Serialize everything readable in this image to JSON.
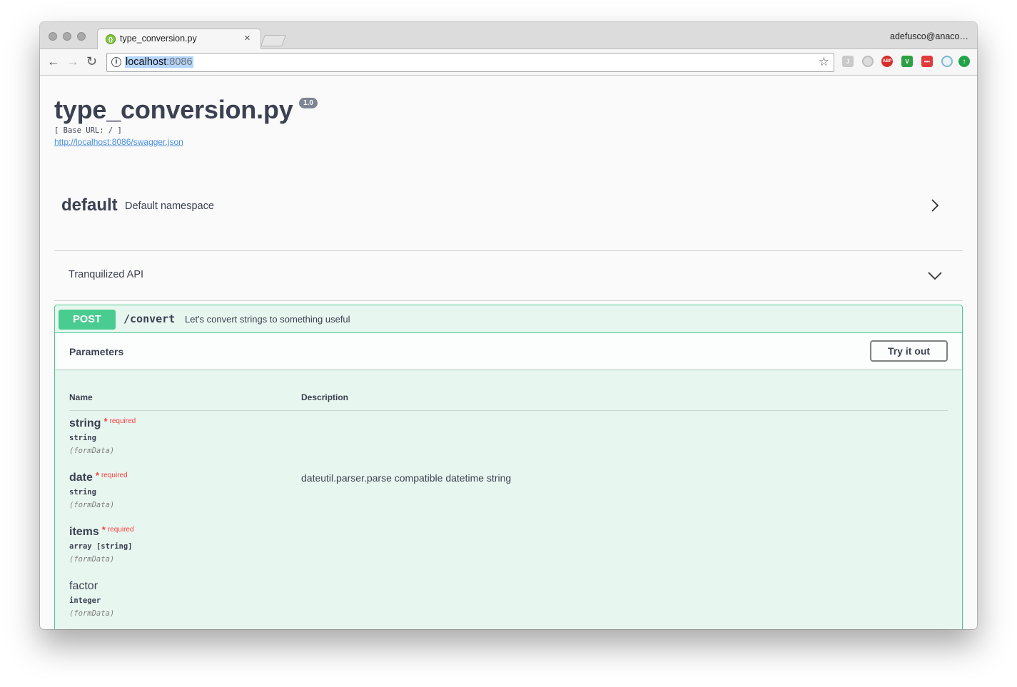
{
  "browser": {
    "tab_title": "type_conversion.py",
    "tab_close": "×",
    "profile_name": "adefusco@anaco…",
    "url_host": "localhost",
    "url_port": ":8086",
    "favicon_glyph": "{}",
    "extensions": [
      "J",
      "ABP",
      "V",
      "•••"
    ]
  },
  "header": {
    "title": "type_conversion.py",
    "version": "1.0",
    "base_url": "[ Base URL: / ]",
    "spec_link": "http://localhost:8086/swagger.json"
  },
  "namespaces": [
    {
      "name": "default",
      "description": "Default namespace",
      "expanded": false
    },
    {
      "name": "",
      "description": "Tranquilized API",
      "expanded": true
    }
  ],
  "operation": {
    "method": "POST",
    "path": "/convert",
    "summary": "Let's convert strings to something useful",
    "parameters_title": "Parameters",
    "try_label": "Try it out",
    "columns": {
      "name": "Name",
      "description": "Description"
    },
    "required_marker": "*",
    "required_label": "required",
    "params": [
      {
        "name": "string",
        "required": true,
        "type": "string",
        "in": "(formData)",
        "description": ""
      },
      {
        "name": "date",
        "required": true,
        "type": "string",
        "in": "(formData)",
        "description": "dateutil.parser.parse compatible datetime string"
      },
      {
        "name": "items",
        "required": true,
        "type": "array [string]",
        "in": "(formData)",
        "description": ""
      },
      {
        "name": "factor",
        "required": false,
        "type": "integer",
        "in": "(formData)",
        "description": ""
      }
    ]
  },
  "colors": {
    "post": "#49cc90",
    "post_bg": "#e8f6f0",
    "text": "#3b4151",
    "required": "#ff3c3c",
    "link": "#4990e2"
  }
}
